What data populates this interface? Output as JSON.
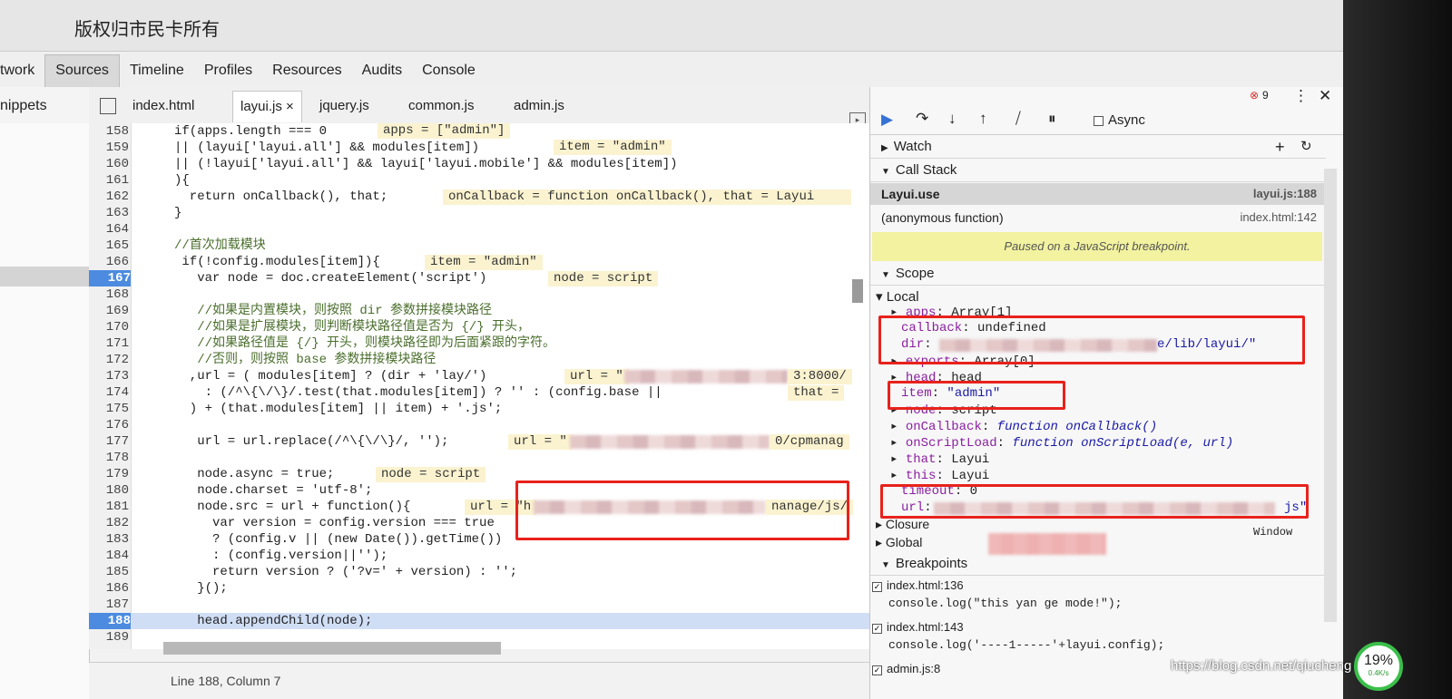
{
  "window": {
    "title": "版权归市民卡所有"
  },
  "main_tabs": [
    "twork",
    "Sources",
    "Timeline",
    "Profiles",
    "Resources",
    "Audits",
    "Console"
  ],
  "left_tab": "nippets",
  "file_tabs": [
    {
      "label": "index.html"
    },
    {
      "label": "layui.js ×"
    },
    {
      "label": "jquery.js"
    },
    {
      "label": "common.js"
    },
    {
      "label": "admin.js"
    }
  ],
  "code_lines": [
    {
      "n": "158",
      "code": "if(apps.length === 0"
    },
    {
      "n": "159",
      "code": "|| (layui['layui.all'] && modules[item])"
    },
    {
      "n": "160",
      "code": "|| (!layui['layui.all'] && layui['layui.mobile'] && modules[item])"
    },
    {
      "n": "161",
      "code": "){"
    },
    {
      "n": "162",
      "code": "  return onCallback(), that;"
    },
    {
      "n": "163",
      "code": "}"
    },
    {
      "n": "164",
      "code": ""
    },
    {
      "n": "165",
      "code": "//首次加载模块"
    },
    {
      "n": "166",
      "code": " if(!config.modules[item]){"
    },
    {
      "n": "167",
      "code": "   var node = doc.createElement('script')"
    },
    {
      "n": "168",
      "code": ""
    },
    {
      "n": "169",
      "code": "   //如果是内置模块，则按照 dir 参数拼接模块路径"
    },
    {
      "n": "170",
      "code": "   //如果是扩展模块，则判断模块路径值是否为 {/} 开头，"
    },
    {
      "n": "171",
      "code": "   //如果路径值是 {/} 开头，则模块路径即为后面紧跟的字符。"
    },
    {
      "n": "172",
      "code": "   //否则，则按照 base 参数拼接模块路径"
    },
    {
      "n": "173",
      "code": "  ,url = ( modules[item] ? (dir + 'lay/')"
    },
    {
      "n": "174",
      "code": "    : (/^\\{\\/\\}/.test(that.modules[item]) ? '' : (config.base ||"
    },
    {
      "n": "175",
      "code": "  ) + (that.modules[item] || item) + '.js';"
    },
    {
      "n": "176",
      "code": ""
    },
    {
      "n": "177",
      "code": "   url = url.replace(/^\\{\\/\\}/, '');"
    },
    {
      "n": "178",
      "code": ""
    },
    {
      "n": "179",
      "code": "   node.async = true;"
    },
    {
      "n": "180",
      "code": "   node.charset = 'utf-8';"
    },
    {
      "n": "181",
      "code": "   node.src = url + function(){"
    },
    {
      "n": "182",
      "code": "     var version = config.version === true"
    },
    {
      "n": "183",
      "code": "     ? (config.v || (new Date()).getTime())"
    },
    {
      "n": "184",
      "code": "     : (config.version||'');"
    },
    {
      "n": "185",
      "code": "     return version ? ('?v=' + version) : '';"
    },
    {
      "n": "186",
      "code": "   }();"
    },
    {
      "n": "187",
      "code": ""
    },
    {
      "n": "188",
      "code": "   head.appendChild(node);"
    },
    {
      "n": "189",
      "code": ""
    }
  ],
  "inline_values": {
    "v158": "apps = [\"admin\"]",
    "v159": "item = \"admin\"",
    "v162": "onCallback = function onCallback(), that = Layui",
    "v166": "item = \"admin\"",
    "v167": "node = script",
    "v173a": "url = \"",
    "v173b": "3:8000/",
    "v174": "that =",
    "v177a": "url = \"",
    "v177b": "0/cpmanag",
    "v179": "node = script",
    "v181a": "url = \"h",
    "v181b": "nanage/js/"
  },
  "status": {
    "position": "Line 188, Column 7"
  },
  "debugger": {
    "async_label": "Async",
    "error_count": "9",
    "watch_label": "Watch",
    "callstack_label": "Call Stack",
    "frames": [
      {
        "name": "Layui.use",
        "location": "layui.js:188"
      },
      {
        "name": "(anonymous function)",
        "location": "index.html:142"
      }
    ],
    "paused_message": "Paused on a JavaScript breakpoint.",
    "scope_label": "Scope",
    "local_label": "Local",
    "scope_vars": [
      {
        "key": "apps",
        "value": "Array[1]"
      },
      {
        "key": "callback",
        "value": "undefined"
      },
      {
        "key": "dir",
        "value": "e/lib/layui/\""
      },
      {
        "key": "exports",
        "value": "Array[0]"
      },
      {
        "key": "head",
        "value": "head"
      },
      {
        "key": "item",
        "value": "\"admin\""
      },
      {
        "key": "node",
        "value": "script"
      },
      {
        "key": "onCallback",
        "value": "function onCallback()"
      },
      {
        "key": "onScriptLoad",
        "value": "function onScriptLoad(e, url)"
      },
      {
        "key": "that",
        "value": "Layui"
      },
      {
        "key": "this",
        "value": "Layui"
      },
      {
        "key": "timeout",
        "value": "0"
      },
      {
        "key": "url",
        "value": "js\""
      }
    ],
    "closure_label": "Closure",
    "global_label": "Global",
    "global_value": "Window",
    "breakpoints_label": "Breakpoints",
    "breakpoints": [
      {
        "file": "index.html:136",
        "code": "console.log(\"this yan ge mode!\");"
      },
      {
        "file": "index.html:143",
        "code": "console.log('----1-----'+layui.config);"
      },
      {
        "file": "admin.js:8",
        "code": ""
      }
    ]
  },
  "watermark": "https://blog.csdn.net/qiucheng",
  "net_badge": {
    "percent": "19%",
    "speed": "0.4K/s"
  },
  "colors": {
    "breakpoint": "#4c8be0",
    "paused_banner": "#f2f2a0",
    "highlight_box": "#e8221c",
    "inline_value_bg": "#fbf3d0"
  }
}
